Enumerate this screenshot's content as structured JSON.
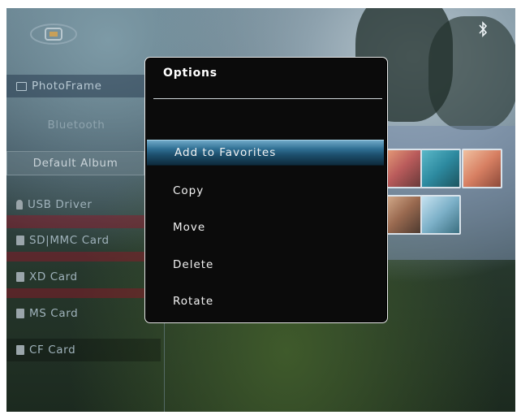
{
  "screen": {
    "bluetooth_icon": "bluetooth-icon",
    "logo_icon": "photoframe-logo-icon"
  },
  "sidebar": {
    "items": [
      {
        "label": "PhotoFrame",
        "icon": "photoframe-icon"
      },
      {
        "label": "Bluetooth",
        "icon": ""
      },
      {
        "label": "Default Album",
        "icon": ""
      },
      {
        "label": "USB Driver",
        "icon": "usb-icon"
      },
      {
        "label": "SD|MMC Card",
        "icon": "card-icon"
      },
      {
        "label": "XD Card",
        "icon": "card-icon"
      },
      {
        "label": "MS Card",
        "icon": "card-icon"
      },
      {
        "label": "CF Card",
        "icon": "card-icon"
      }
    ]
  },
  "dialog": {
    "title": "Options",
    "items": [
      {
        "label": "Add to Favorites",
        "selected": true
      },
      {
        "label": "Copy",
        "selected": false
      },
      {
        "label": "Move",
        "selected": false
      },
      {
        "label": "Delete",
        "selected": false
      },
      {
        "label": "Rotate",
        "selected": false
      }
    ]
  },
  "colors": {
    "highlight": "#2f6f93",
    "dialog_bg": "#0b0b0b"
  }
}
